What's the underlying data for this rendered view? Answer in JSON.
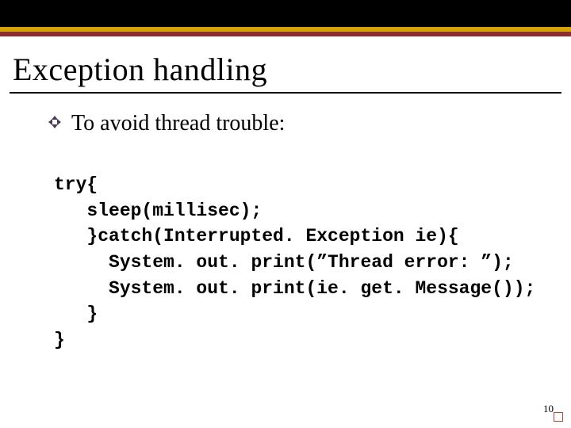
{
  "slide": {
    "title": "Exception handling",
    "bullet": "To avoid thread trouble:",
    "code_lines": [
      "try{",
      "   sleep(millisec);",
      "   }catch(Interrupted. Exception ie){",
      "     System. out. print(”Thread error: ”);",
      "     System. out. print(ie. get. Message());",
      "   }",
      "}"
    ],
    "slide_number": "10"
  }
}
